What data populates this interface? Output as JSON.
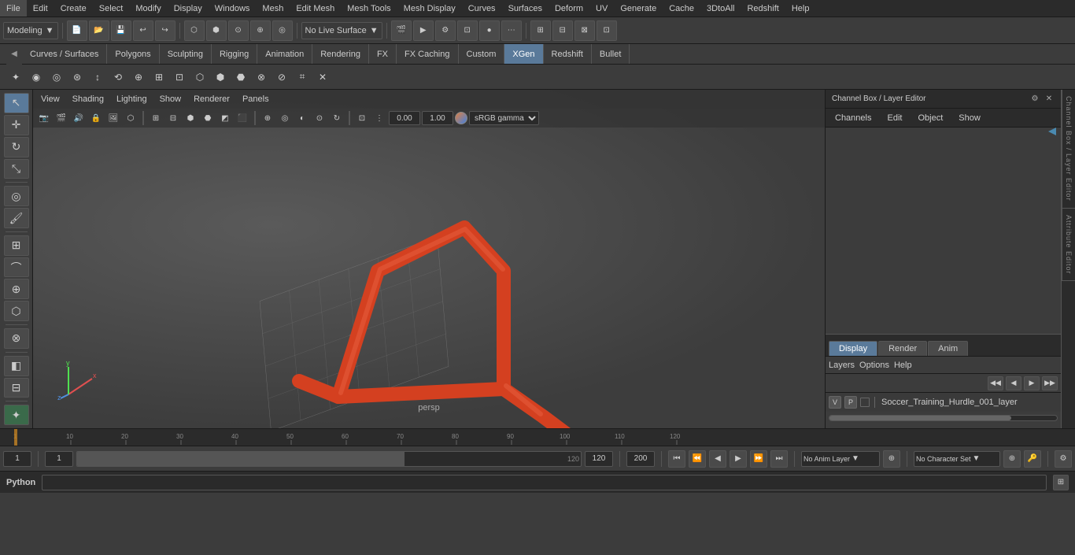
{
  "app": {
    "title": "Autodesk Maya"
  },
  "menu": {
    "items": [
      "File",
      "Edit",
      "Create",
      "Select",
      "Modify",
      "Display",
      "Windows",
      "Mesh",
      "Edit Mesh",
      "Mesh Tools",
      "Mesh Display",
      "Curves",
      "Surfaces",
      "Deform",
      "UV",
      "Generate",
      "Cache",
      "3DtoAll",
      "Redshift",
      "Help"
    ]
  },
  "toolbar": {
    "mode_label": "Modeling",
    "live_surface_label": "No Live Surface"
  },
  "tabs": {
    "items": [
      "Curves / Surfaces",
      "Polygons",
      "Sculpting",
      "Rigging",
      "Animation",
      "Rendering",
      "FX",
      "FX Caching",
      "Custom",
      "XGen",
      "Redshift",
      "Bullet"
    ],
    "active": "XGen"
  },
  "viewport": {
    "menus": [
      "View",
      "Shading",
      "Lighting",
      "Show",
      "Renderer",
      "Panels"
    ],
    "camera_label": "persp",
    "color_space": "sRGB gamma",
    "cam_near": "0.00",
    "cam_far": "1.00"
  },
  "channel_box": {
    "title": "Channel Box / Layer Editor",
    "tabs": [
      "Channels",
      "Edit",
      "Object",
      "Show"
    ]
  },
  "layer_editor": {
    "tabs": [
      "Display",
      "Render",
      "Anim"
    ],
    "active_tab": "Display",
    "options": [
      "Layers",
      "Options",
      "Help"
    ],
    "layer": {
      "v": "V",
      "p": "P",
      "name": "Soccer_Training_Hurdle_001_layer"
    }
  },
  "timeline": {
    "start": "1",
    "end": "120",
    "current": "1",
    "range_start": "1",
    "range_end": "120",
    "max_range": "200"
  },
  "bottom_bar": {
    "current_frame": "1",
    "range_start": "1",
    "range_label": "120",
    "max_label": "200",
    "no_anim_layer": "No Anim Layer",
    "no_char_set": "No Character Set"
  },
  "python_bar": {
    "label": "Python",
    "placeholder": ""
  },
  "right_vtabs": [
    "Channel Box / Layer Editor",
    "Attribute Editor"
  ],
  "axes": {
    "x_color": "#e05050",
    "y_color": "#50e050",
    "z_color": "#5050e0"
  }
}
